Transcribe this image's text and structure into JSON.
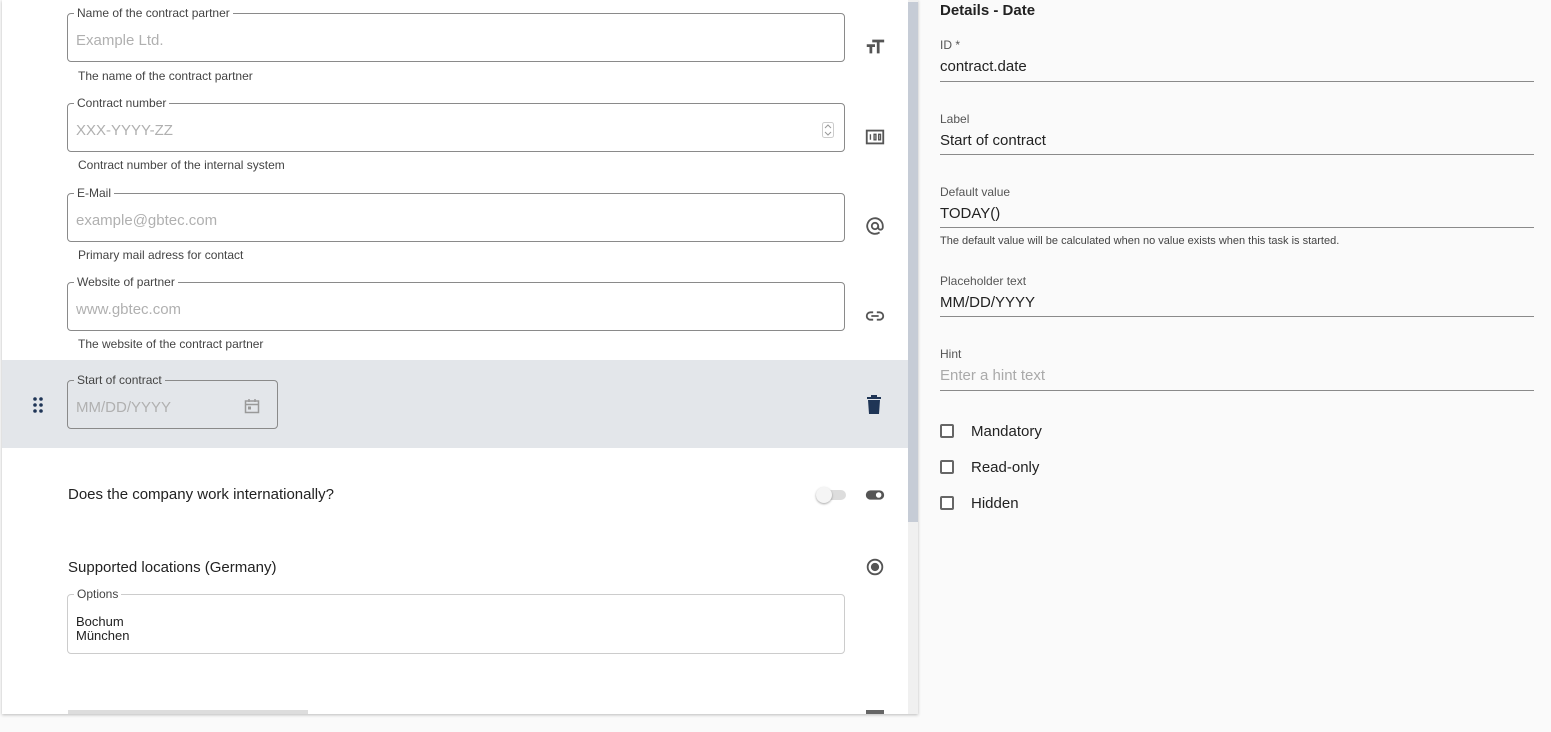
{
  "left": {
    "fields": [
      {
        "legend": "Name of the contract partner",
        "placeholder": "Example Ltd.",
        "hint": "The name of the contract partner",
        "icon": "text-size-icon"
      },
      {
        "legend": "Contract number",
        "placeholder": "XXX-YYYY-ZZ",
        "hint": "Contract number of the internal system",
        "icon": "number-icon"
      },
      {
        "legend": "E-Mail",
        "placeholder": "example@gbtec.com",
        "hint": "Primary mail adress for contact",
        "icon": "at-icon"
      },
      {
        "legend": "Website of partner",
        "placeholder": "www.gbtec.com",
        "hint": "The website of the contract partner",
        "icon": "link-icon"
      }
    ],
    "date_field": {
      "legend": "Start of contract",
      "placeholder": "MM/DD/YYYY"
    },
    "toggle_question": "Does the company work internationally?",
    "radio_title": "Supported locations (Germany)",
    "options_legend": "Options",
    "options": [
      "Bochum",
      "München"
    ],
    "colors": {
      "active_row": "#e3e6ea",
      "icon_dark": "#1f3556"
    }
  },
  "right": {
    "title": "Details - Date",
    "id_label": "ID *",
    "id_value": "contract.date",
    "label_label": "Label",
    "label_value": "Start of contract",
    "default_label": "Default value",
    "default_value": "TODAY()",
    "default_hint": "The default value will be calculated when no value exists when this task is started.",
    "placeholder_label": "Placeholder text",
    "placeholder_value": "MM/DD/YYYY",
    "hint_label": "Hint",
    "hint_placeholder": "Enter a hint text",
    "checkboxes": [
      "Mandatory",
      "Read-only",
      "Hidden"
    ]
  }
}
